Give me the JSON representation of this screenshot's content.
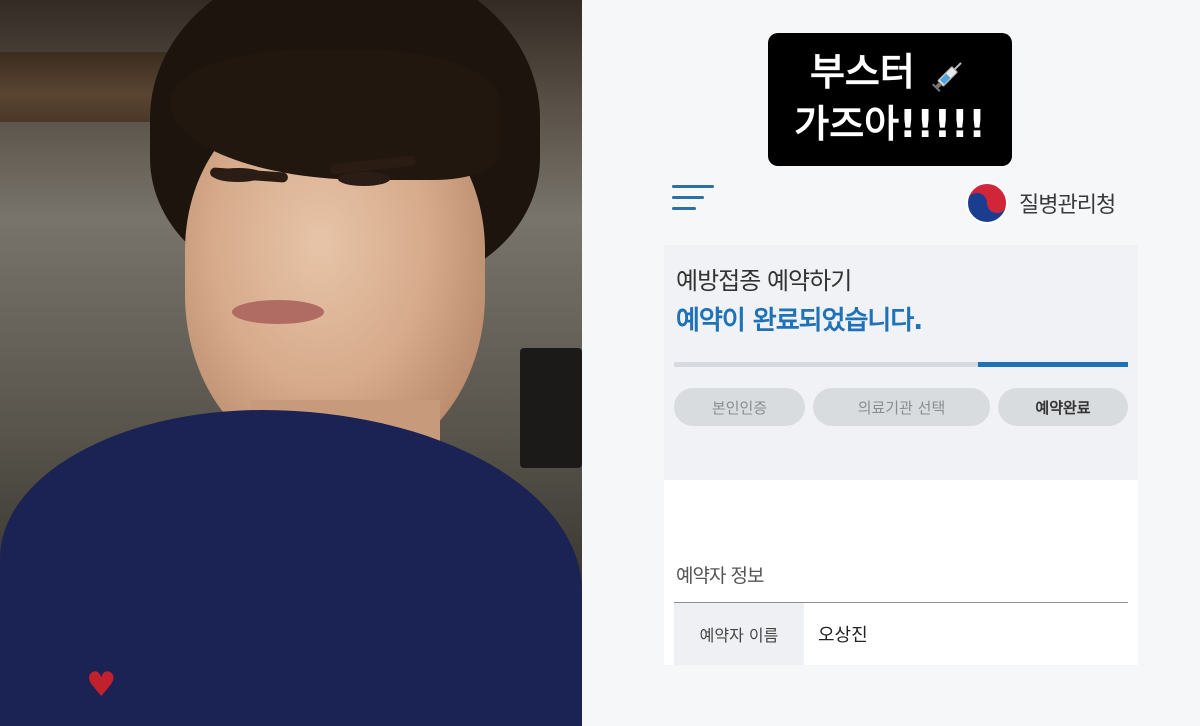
{
  "photo": {
    "alt_icon": "person-selfie-photo",
    "logo_icon": "heart-logo-icon"
  },
  "sticker": {
    "line1": "부스터",
    "line2": "가즈아!!!!!",
    "emoji_icon": "syringe-icon"
  },
  "header": {
    "menu_icon": "hamburger-menu-icon",
    "agency_name": "질병관리청",
    "emblem_icon": "korea-government-emblem-icon"
  },
  "reservation": {
    "title": "예방접종 예약하기",
    "subtitle": "예약이 완료되었습니다.",
    "progress": 0.33,
    "steps": [
      {
        "label": "본인인증",
        "active": false
      },
      {
        "label": "의료기관 선택",
        "active": false
      },
      {
        "label": "예약완료",
        "active": true
      }
    ],
    "section_title": "예약자 정보",
    "rows": [
      {
        "label": "예약자 이름",
        "value": "오상진"
      }
    ]
  },
  "colors": {
    "accent": "#1f72b7",
    "sticker_bg": "#000000",
    "shirt": "#1b2254"
  }
}
